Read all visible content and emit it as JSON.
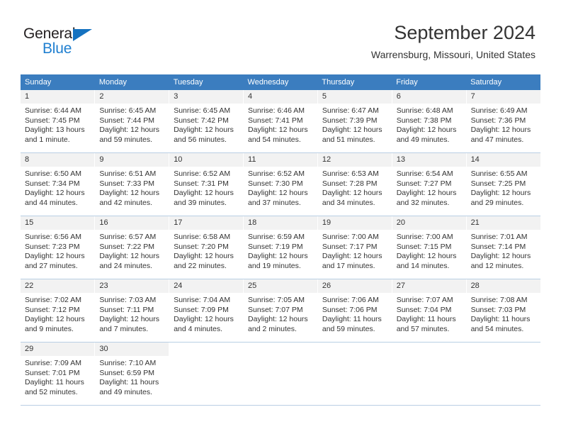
{
  "brand": {
    "name_top": "General",
    "name_bottom": "Blue",
    "triangle_color": "#1572c0",
    "blue_color": "#1f7fd0"
  },
  "header": {
    "title": "September 2024",
    "subtitle": "Warrensburg, Missouri, United States"
  },
  "theme": {
    "header_row_bg": "#3b7dbf",
    "daynum_bg": "#f2f2f2",
    "cell_border": "#b9cfe4",
    "text_color": "#333333"
  },
  "weekdays": [
    "Sunday",
    "Monday",
    "Tuesday",
    "Wednesday",
    "Thursday",
    "Friday",
    "Saturday"
  ],
  "days": [
    {
      "date": "1",
      "sunrise": "Sunrise: 6:44 AM",
      "sunset": "Sunset: 7:45 PM",
      "daylight_1": "Daylight: 13 hours",
      "daylight_2": "and 1 minute."
    },
    {
      "date": "2",
      "sunrise": "Sunrise: 6:45 AM",
      "sunset": "Sunset: 7:44 PM",
      "daylight_1": "Daylight: 12 hours",
      "daylight_2": "and 59 minutes."
    },
    {
      "date": "3",
      "sunrise": "Sunrise: 6:45 AM",
      "sunset": "Sunset: 7:42 PM",
      "daylight_1": "Daylight: 12 hours",
      "daylight_2": "and 56 minutes."
    },
    {
      "date": "4",
      "sunrise": "Sunrise: 6:46 AM",
      "sunset": "Sunset: 7:41 PM",
      "daylight_1": "Daylight: 12 hours",
      "daylight_2": "and 54 minutes."
    },
    {
      "date": "5",
      "sunrise": "Sunrise: 6:47 AM",
      "sunset": "Sunset: 7:39 PM",
      "daylight_1": "Daylight: 12 hours",
      "daylight_2": "and 51 minutes."
    },
    {
      "date": "6",
      "sunrise": "Sunrise: 6:48 AM",
      "sunset": "Sunset: 7:38 PM",
      "daylight_1": "Daylight: 12 hours",
      "daylight_2": "and 49 minutes."
    },
    {
      "date": "7",
      "sunrise": "Sunrise: 6:49 AM",
      "sunset": "Sunset: 7:36 PM",
      "daylight_1": "Daylight: 12 hours",
      "daylight_2": "and 47 minutes."
    },
    {
      "date": "8",
      "sunrise": "Sunrise: 6:50 AM",
      "sunset": "Sunset: 7:34 PM",
      "daylight_1": "Daylight: 12 hours",
      "daylight_2": "and 44 minutes."
    },
    {
      "date": "9",
      "sunrise": "Sunrise: 6:51 AM",
      "sunset": "Sunset: 7:33 PM",
      "daylight_1": "Daylight: 12 hours",
      "daylight_2": "and 42 minutes."
    },
    {
      "date": "10",
      "sunrise": "Sunrise: 6:52 AM",
      "sunset": "Sunset: 7:31 PM",
      "daylight_1": "Daylight: 12 hours",
      "daylight_2": "and 39 minutes."
    },
    {
      "date": "11",
      "sunrise": "Sunrise: 6:52 AM",
      "sunset": "Sunset: 7:30 PM",
      "daylight_1": "Daylight: 12 hours",
      "daylight_2": "and 37 minutes."
    },
    {
      "date": "12",
      "sunrise": "Sunrise: 6:53 AM",
      "sunset": "Sunset: 7:28 PM",
      "daylight_1": "Daylight: 12 hours",
      "daylight_2": "and 34 minutes."
    },
    {
      "date": "13",
      "sunrise": "Sunrise: 6:54 AM",
      "sunset": "Sunset: 7:27 PM",
      "daylight_1": "Daylight: 12 hours",
      "daylight_2": "and 32 minutes."
    },
    {
      "date": "14",
      "sunrise": "Sunrise: 6:55 AM",
      "sunset": "Sunset: 7:25 PM",
      "daylight_1": "Daylight: 12 hours",
      "daylight_2": "and 29 minutes."
    },
    {
      "date": "15",
      "sunrise": "Sunrise: 6:56 AM",
      "sunset": "Sunset: 7:23 PM",
      "daylight_1": "Daylight: 12 hours",
      "daylight_2": "and 27 minutes."
    },
    {
      "date": "16",
      "sunrise": "Sunrise: 6:57 AM",
      "sunset": "Sunset: 7:22 PM",
      "daylight_1": "Daylight: 12 hours",
      "daylight_2": "and 24 minutes."
    },
    {
      "date": "17",
      "sunrise": "Sunrise: 6:58 AM",
      "sunset": "Sunset: 7:20 PM",
      "daylight_1": "Daylight: 12 hours",
      "daylight_2": "and 22 minutes."
    },
    {
      "date": "18",
      "sunrise": "Sunrise: 6:59 AM",
      "sunset": "Sunset: 7:19 PM",
      "daylight_1": "Daylight: 12 hours",
      "daylight_2": "and 19 minutes."
    },
    {
      "date": "19",
      "sunrise": "Sunrise: 7:00 AM",
      "sunset": "Sunset: 7:17 PM",
      "daylight_1": "Daylight: 12 hours",
      "daylight_2": "and 17 minutes."
    },
    {
      "date": "20",
      "sunrise": "Sunrise: 7:00 AM",
      "sunset": "Sunset: 7:15 PM",
      "daylight_1": "Daylight: 12 hours",
      "daylight_2": "and 14 minutes."
    },
    {
      "date": "21",
      "sunrise": "Sunrise: 7:01 AM",
      "sunset": "Sunset: 7:14 PM",
      "daylight_1": "Daylight: 12 hours",
      "daylight_2": "and 12 minutes."
    },
    {
      "date": "22",
      "sunrise": "Sunrise: 7:02 AM",
      "sunset": "Sunset: 7:12 PM",
      "daylight_1": "Daylight: 12 hours",
      "daylight_2": "and 9 minutes."
    },
    {
      "date": "23",
      "sunrise": "Sunrise: 7:03 AM",
      "sunset": "Sunset: 7:11 PM",
      "daylight_1": "Daylight: 12 hours",
      "daylight_2": "and 7 minutes."
    },
    {
      "date": "24",
      "sunrise": "Sunrise: 7:04 AM",
      "sunset": "Sunset: 7:09 PM",
      "daylight_1": "Daylight: 12 hours",
      "daylight_2": "and 4 minutes."
    },
    {
      "date": "25",
      "sunrise": "Sunrise: 7:05 AM",
      "sunset": "Sunset: 7:07 PM",
      "daylight_1": "Daylight: 12 hours",
      "daylight_2": "and 2 minutes."
    },
    {
      "date": "26",
      "sunrise": "Sunrise: 7:06 AM",
      "sunset": "Sunset: 7:06 PM",
      "daylight_1": "Daylight: 11 hours",
      "daylight_2": "and 59 minutes."
    },
    {
      "date": "27",
      "sunrise": "Sunrise: 7:07 AM",
      "sunset": "Sunset: 7:04 PM",
      "daylight_1": "Daylight: 11 hours",
      "daylight_2": "and 57 minutes."
    },
    {
      "date": "28",
      "sunrise": "Sunrise: 7:08 AM",
      "sunset": "Sunset: 7:03 PM",
      "daylight_1": "Daylight: 11 hours",
      "daylight_2": "and 54 minutes."
    },
    {
      "date": "29",
      "sunrise": "Sunrise: 7:09 AM",
      "sunset": "Sunset: 7:01 PM",
      "daylight_1": "Daylight: 11 hours",
      "daylight_2": "and 52 minutes."
    },
    {
      "date": "30",
      "sunrise": "Sunrise: 7:10 AM",
      "sunset": "Sunset: 6:59 PM",
      "daylight_1": "Daylight: 11 hours",
      "daylight_2": "and 49 minutes."
    }
  ]
}
